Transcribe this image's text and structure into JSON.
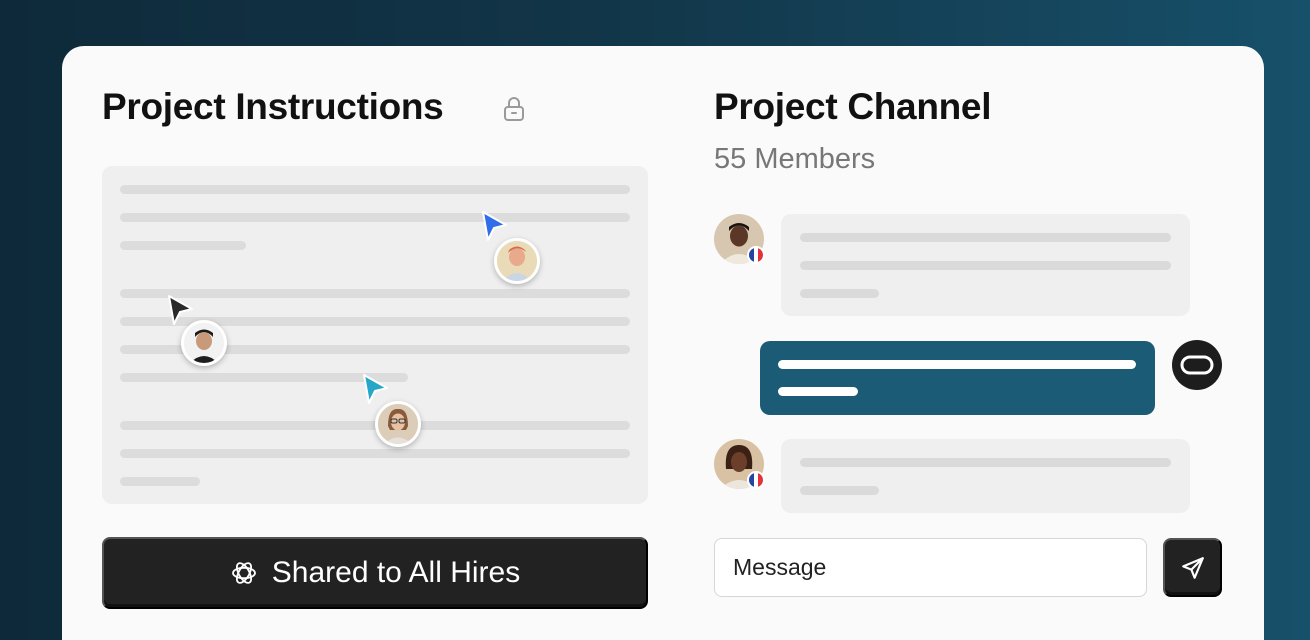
{
  "left": {
    "title": "Project Instructions",
    "lock_icon": "lock-icon",
    "shared_button_label": "Shared to All Hires",
    "shared_icon": "openai-knot-icon"
  },
  "right": {
    "title": "Project Channel",
    "members": "55 Members",
    "message_placeholder": "Message",
    "send_icon": "send-icon"
  },
  "colors": {
    "outgoing_bubble": "#1c5b76",
    "button_dark": "#222222",
    "cursor_blue": "#2f6ee8",
    "cursor_cyan": "#27a7c7",
    "cursor_dark": "#2a2a2a"
  }
}
